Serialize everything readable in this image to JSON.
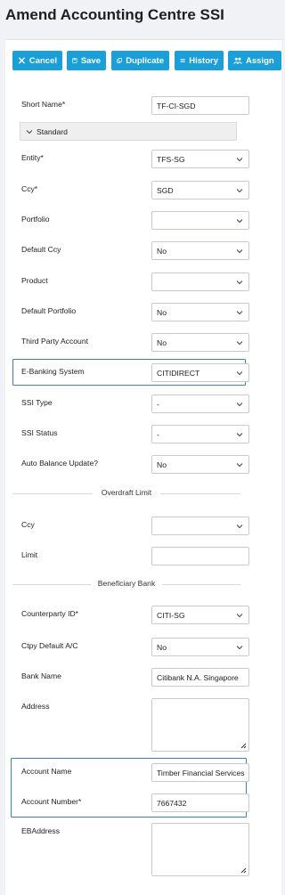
{
  "page": {
    "title": "Amend Accounting Centre SSI"
  },
  "toolbar": {
    "cancel": "Cancel",
    "save": "Save",
    "duplicate": "Duplicate",
    "history": "History",
    "assign": "Assign"
  },
  "section": {
    "standard": "Standard"
  },
  "fields": {
    "short_name": {
      "label": "Short Name*",
      "value": "TF-CI-SGD"
    },
    "entity": {
      "label": "Entity*",
      "value": "TFS-SG"
    },
    "ccy": {
      "label": "Ccy*",
      "value": "SGD"
    },
    "portfolio": {
      "label": "Portfolio",
      "value": ""
    },
    "default_ccy": {
      "label": "Default Ccy",
      "value": "No"
    },
    "product": {
      "label": "Product",
      "value": ""
    },
    "default_portfolio": {
      "label": "Default Portfolio",
      "value": "No"
    },
    "third_party_account": {
      "label": "Third Party Account",
      "value": "No"
    },
    "ebanking_system": {
      "label": "E-Banking System",
      "value": "CITIDIRECT"
    },
    "ssi_type": {
      "label": "SSI Type",
      "value": "-"
    },
    "ssi_status": {
      "label": "SSI Status",
      "value": "-"
    },
    "auto_balance_update": {
      "label": "Auto Balance Update?",
      "value": "No"
    }
  },
  "overdraft": {
    "heading": "Overdraft Limit",
    "ccy": {
      "label": "Ccy",
      "value": ""
    },
    "limit": {
      "label": "Limit",
      "value": ""
    }
  },
  "beneficiary": {
    "heading": "Beneficiary Bank",
    "counterparty_id": {
      "label": "Counterparty ID*",
      "value": "CITI-SG"
    },
    "ctpy_default_ac": {
      "label": "Ctpy Default A/C",
      "value": "No"
    },
    "bank_name": {
      "label": "Bank Name",
      "value": "Citibank N.A. Singapore"
    },
    "address": {
      "label": "Address",
      "value": ""
    },
    "account_name": {
      "label": "Account Name",
      "value": "Timber Financial Services"
    },
    "account_number": {
      "label": "Account Number*",
      "value": "7667432"
    },
    "eb_address": {
      "label": "EBAddress",
      "value": ""
    }
  },
  "colors": {
    "accent": "#1a9fd8",
    "highlight": "#3f7fbf"
  }
}
